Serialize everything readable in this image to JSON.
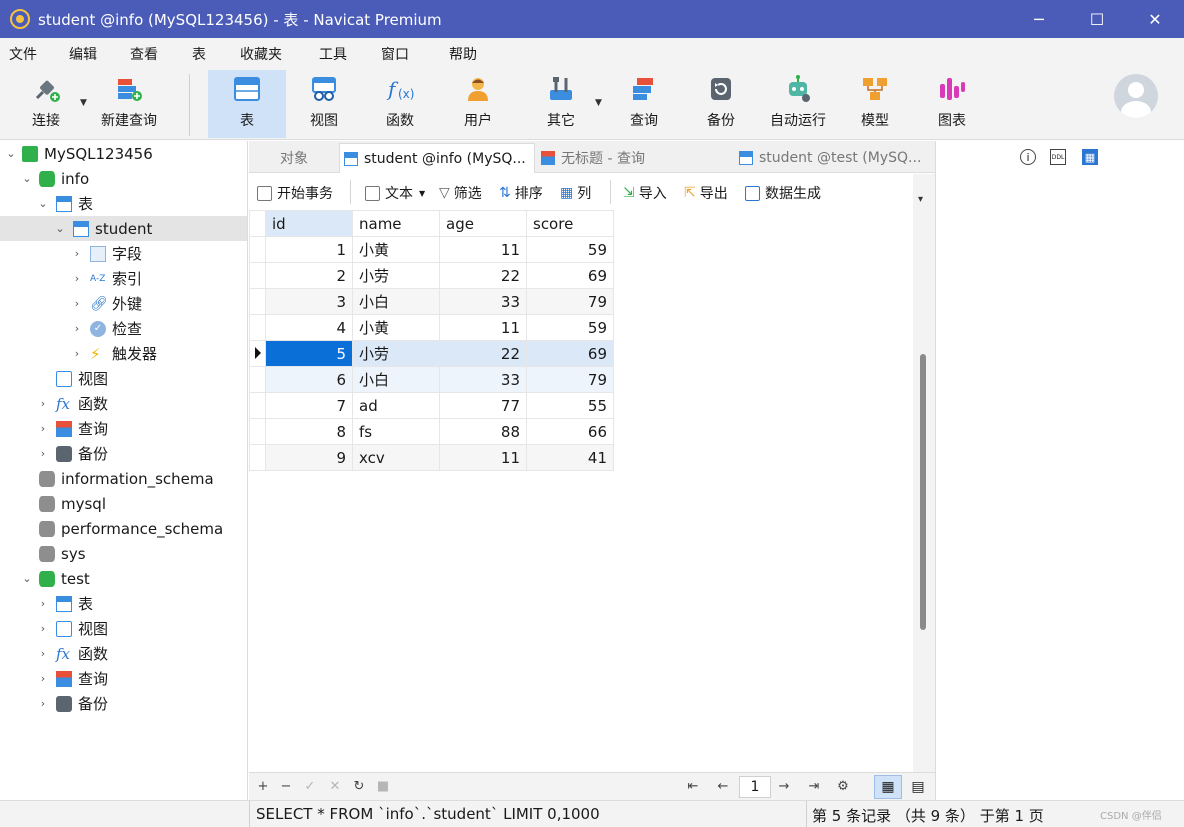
{
  "window": {
    "title": "student @info (MySQL123456) - 表 - Navicat Premium",
    "minimize": "─",
    "maximize": "☐",
    "close": "✕"
  },
  "menu": [
    "文件",
    "编辑",
    "查看",
    "表",
    "收藏夹",
    "工具",
    "窗口",
    "帮助"
  ],
  "toolbar": {
    "connect": "连接",
    "new_query": "新建查询",
    "table": "表",
    "view": "视图",
    "function": "函数",
    "user": "用户",
    "other": "其它",
    "query": "查询",
    "backup": "备份",
    "automation": "自动运行",
    "model": "模型",
    "chart": "图表"
  },
  "tree": {
    "connection": "MySQL123456",
    "db_info": "info",
    "tables": "表",
    "student": "student",
    "fields": "字段",
    "indexes": "索引",
    "foreign_keys": "外键",
    "checks": "检查",
    "triggers": "触发器",
    "views": "视图",
    "functions": "函数",
    "queries": "查询",
    "backups": "备份",
    "db_information_schema": "information_schema",
    "db_mysql": "mysql",
    "db_performance_schema": "performance_schema",
    "db_sys": "sys",
    "db_test": "test",
    "test_tables": "表",
    "test_views": "视图",
    "test_functions": "函数",
    "test_queries": "查询",
    "test_backups": "备份"
  },
  "tabs": {
    "objects": "对象",
    "student_info": "student @info (MySQ...",
    "untitled_query": "无标题 - 查询",
    "student_test": "student @test (MySQ..."
  },
  "grid_toolbar": {
    "begin_transaction": "开始事务",
    "text": "文本",
    "filter": "筛选",
    "sort": "排序",
    "columns": "列",
    "import": "导入",
    "export": "导出",
    "data_generation": "数据生成"
  },
  "table": {
    "columns": [
      "id",
      "name",
      "age",
      "score"
    ],
    "rows": [
      [
        "1",
        "小黄",
        "11",
        "59"
      ],
      [
        "2",
        "小劳",
        "22",
        "69"
      ],
      [
        "3",
        "小白",
        "33",
        "79"
      ],
      [
        "4",
        "小黄",
        "11",
        "59"
      ],
      [
        "5",
        "小劳",
        "22",
        "69"
      ],
      [
        "6",
        "小白",
        "33",
        "79"
      ],
      [
        "7",
        "ad",
        "77",
        "55"
      ],
      [
        "8",
        "fs",
        "88",
        "66"
      ],
      [
        "9",
        "xcv",
        "11",
        "41"
      ]
    ],
    "selected_row": 5
  },
  "pager": {
    "page": "1"
  },
  "status": {
    "sql": "SELECT * FROM `info`.`student` LIMIT 0,1000",
    "records": "第 5 条记录 （共 9 条） 于第 1 页",
    "watermark": "CSDN @伴侣"
  },
  "colors": {
    "titlebar": "#4a5bb8",
    "selection": "#0a6fd6",
    "active_tool": "#cfe2f7"
  }
}
